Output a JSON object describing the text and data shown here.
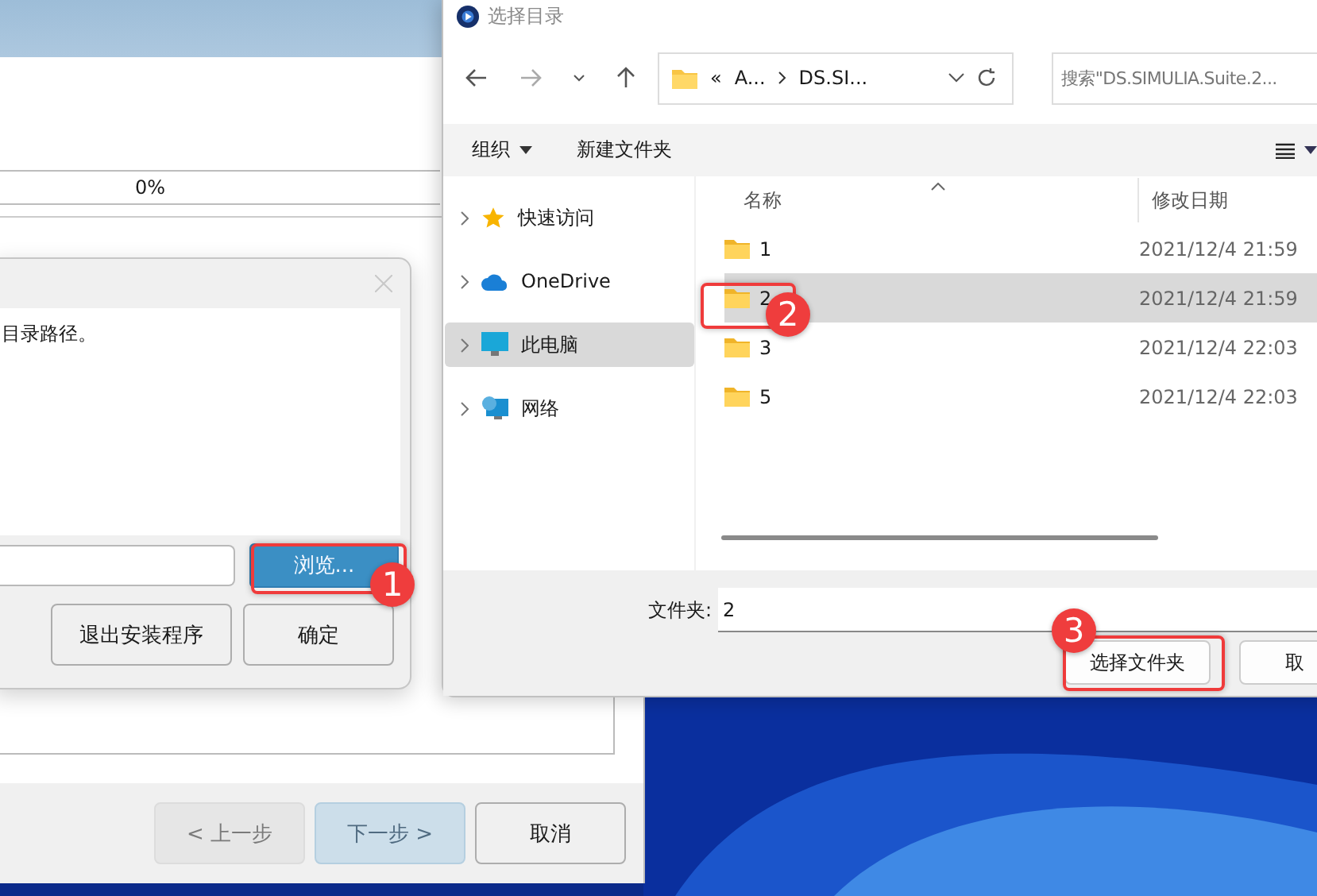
{
  "installer": {
    "progress": {
      "level": 0,
      "reading": "0%"
    },
    "buttons": [
      {
        "label": "< 上一步",
        "disabled": true,
        "primary": false
      },
      {
        "label": "下一步 >",
        "disabled": true,
        "primary": true
      },
      {
        "label": "取消",
        "disabled": false,
        "primary": false
      }
    ]
  },
  "path_dialog": {
    "message": "目录路径。",
    "browse_button": "浏览...",
    "buttons": [
      "退出安装程序",
      "确定"
    ]
  },
  "file_dialog": {
    "title": "选择目录",
    "breadcrumb": [
      "«",
      "A...",
      "DS.SI..."
    ],
    "search": {
      "placeholder": "搜索\"DS.SIMULIA.Suite.2..."
    },
    "toolbar": [
      "组织",
      "新建文件夹"
    ],
    "sidebar": [
      {
        "label": "快速访问",
        "kind": "star",
        "selected": false
      },
      {
        "label": "OneDrive",
        "kind": "cloud",
        "selected": false
      },
      {
        "label": "此电脑",
        "kind": "pc",
        "selected": true
      },
      {
        "label": "网络",
        "kind": "network",
        "selected": false
      }
    ],
    "columns": [
      "名称",
      "修改日期"
    ],
    "rows": [
      {
        "name": "1",
        "modified": "2021/12/4 21:59",
        "selected": false
      },
      {
        "name": "2",
        "modified": "2021/12/4 21:59",
        "selected": true
      },
      {
        "name": "3",
        "modified": "2021/12/4 22:03",
        "selected": false
      },
      {
        "name": "5",
        "modified": "2021/12/4 22:03",
        "selected": false
      }
    ],
    "folder_label": "文件夹:",
    "folder_value": "2",
    "buttons": [
      "选择文件夹",
      "取"
    ]
  },
  "annotations": [
    {
      "label": "1"
    },
    {
      "label": "2"
    },
    {
      "label": "3"
    }
  ]
}
